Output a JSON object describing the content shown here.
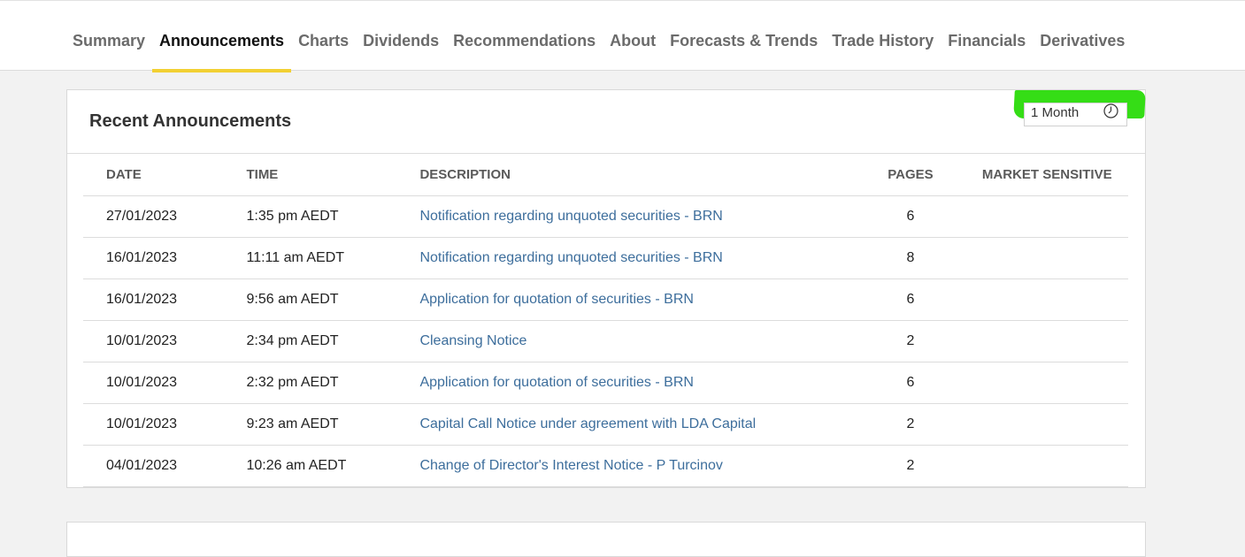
{
  "nav": {
    "tabs": [
      {
        "label": "Summary"
      },
      {
        "label": "Announcements"
      },
      {
        "label": "Charts"
      },
      {
        "label": "Dividends"
      },
      {
        "label": "Recommendations"
      },
      {
        "label": "About"
      },
      {
        "label": "Forecasts & Trends"
      },
      {
        "label": "Trade History"
      },
      {
        "label": "Financials"
      },
      {
        "label": "Derivatives"
      }
    ],
    "active_tab": "Announcements",
    "active_color": "#f2d033"
  },
  "announcements": {
    "title": "Recent Announcements",
    "range": {
      "label": "1 Month",
      "icon": "clock-icon",
      "highlight_color": "#35dd16"
    },
    "columns": {
      "date": "DATE",
      "time": "TIME",
      "description": "DESCRIPTION",
      "pages": "PAGES",
      "market_sensitive": "MARKET SENSITIVE"
    },
    "rows": [
      {
        "date": "27/01/2023",
        "time": "1:35 pm AEDT",
        "description": "Notification regarding unquoted securities - BRN",
        "pages": "6"
      },
      {
        "date": "16/01/2023",
        "time": "11:11 am AEDT",
        "description": "Notification regarding unquoted securities - BRN",
        "pages": "8"
      },
      {
        "date": "16/01/2023",
        "time": "9:56 am AEDT",
        "description": "Application for quotation of securities - BRN",
        "pages": "6"
      },
      {
        "date": "10/01/2023",
        "time": "2:34 pm AEDT",
        "description": "Cleansing Notice",
        "pages": "2"
      },
      {
        "date": "10/01/2023",
        "time": "2:32 pm AEDT",
        "description": "Application for quotation of securities - BRN",
        "pages": "6"
      },
      {
        "date": "10/01/2023",
        "time": "9:23 am AEDT",
        "description": "Capital Call Notice under agreement with LDA Capital",
        "pages": "2"
      },
      {
        "date": "04/01/2023",
        "time": "10:26 am AEDT",
        "description": "Change of Director's Interest Notice - P Turcinov",
        "pages": "2"
      }
    ]
  }
}
